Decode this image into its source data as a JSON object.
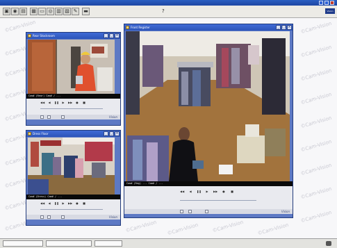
{
  "app": {
    "title": "",
    "menubar_help": "?",
    "logo_text": "Vision"
  },
  "toolbar": {
    "icons": [
      "open-icon",
      "camera-icon",
      "film-icon",
      "grid-icon",
      "window-icon",
      "stack-icon",
      "lock-icon",
      "folder-icon",
      "settings-icon",
      "minimize-icon"
    ]
  },
  "windows": {
    "rear": {
      "title": "Rear Stockroom",
      "status": "Cam# (Rear) Cam# / ...",
      "brand": "Vision"
    },
    "front": {
      "title": "Front Register",
      "status": "Cam# (Reg) ... Cam# / ...",
      "brand": "Vision"
    },
    "dress": {
      "title": "Dress Floor",
      "status": "Cam# (Dress) Cam# / ...",
      "brand": "Vision"
    }
  },
  "watermark": {
    "text": "©Cam-Vision"
  },
  "statusbar": {
    "field1": "",
    "field2": "",
    "field3": ""
  },
  "colors": {
    "window_border": "#223b7c",
    "window_titlebar": "#2d55b9",
    "workspace_bg": "#f7f7f9"
  }
}
